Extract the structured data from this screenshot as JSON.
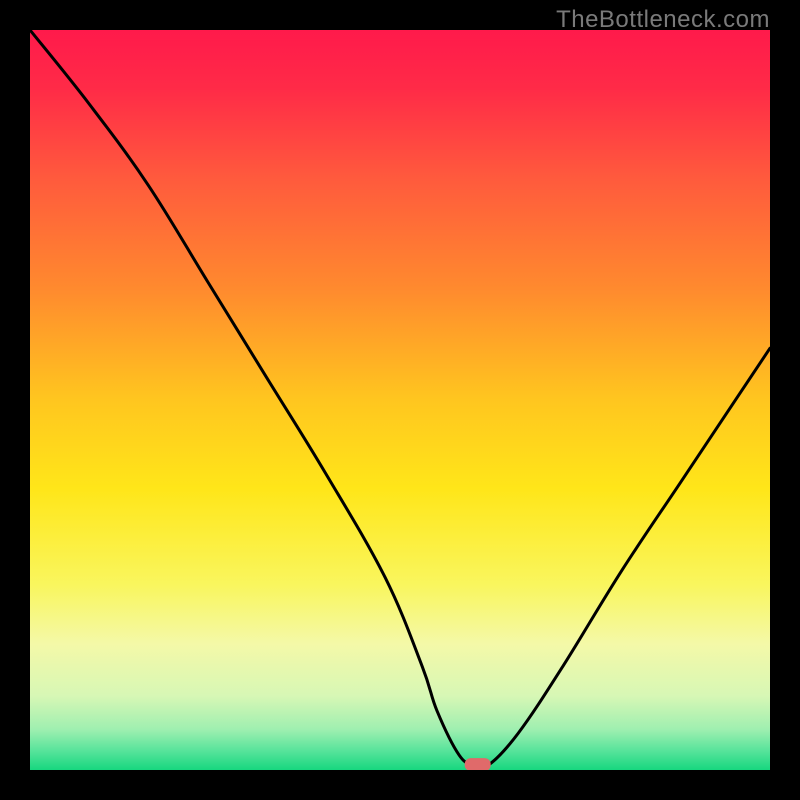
{
  "watermark": "TheBottleneck.com",
  "chart_data": {
    "type": "line",
    "title": "",
    "xlabel": "",
    "ylabel": "",
    "xlim": [
      0,
      100
    ],
    "ylim": [
      0,
      100
    ],
    "x": [
      0,
      8,
      16,
      24,
      32,
      40,
      48,
      53,
      55,
      58,
      60,
      62,
      66,
      72,
      80,
      88,
      96,
      100
    ],
    "values": [
      100,
      90,
      79,
      66,
      53,
      40,
      26,
      14,
      8,
      2,
      0.7,
      0.7,
      5,
      14,
      27,
      39,
      51,
      57
    ],
    "gradient_stops": [
      {
        "offset": 0,
        "color": "#ff1a4b"
      },
      {
        "offset": 0.08,
        "color": "#ff2b47"
      },
      {
        "offset": 0.2,
        "color": "#ff5a3d"
      },
      {
        "offset": 0.35,
        "color": "#ff8a2e"
      },
      {
        "offset": 0.5,
        "color": "#ffc61f"
      },
      {
        "offset": 0.62,
        "color": "#ffe619"
      },
      {
        "offset": 0.75,
        "color": "#f9f65e"
      },
      {
        "offset": 0.83,
        "color": "#f4f9a8"
      },
      {
        "offset": 0.9,
        "color": "#d7f7b5"
      },
      {
        "offset": 0.945,
        "color": "#9fefb0"
      },
      {
        "offset": 0.975,
        "color": "#55e39a"
      },
      {
        "offset": 1.0,
        "color": "#17d77f"
      }
    ],
    "marker": {
      "x": 60.5,
      "y": 0.8,
      "color": "#e06a6a"
    }
  }
}
